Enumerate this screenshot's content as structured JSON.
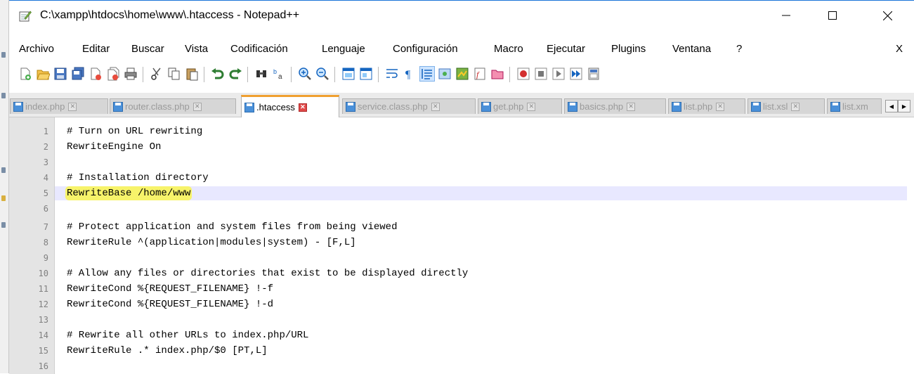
{
  "window": {
    "title": "C:\\xampp\\htdocs\\home\\www\\.htaccess - Notepad++",
    "minimize_label": "—",
    "maximize_label": "☐",
    "close_label": "✕"
  },
  "menu": {
    "items": [
      "Archivo",
      "Editar",
      "Buscar",
      "Vista",
      "Codificación",
      "Lenguaje",
      "Configuración",
      "Macro",
      "Ejecutar",
      "Plugins",
      "Ventana",
      "?"
    ],
    "close_label": "X"
  },
  "toolbar": {
    "icons": [
      "new-file",
      "open-file",
      "save",
      "save-all",
      "close",
      "close-all",
      "print",
      "cut",
      "copy",
      "paste",
      "undo",
      "redo",
      "find",
      "replace",
      "zoom-in",
      "zoom-out",
      "sync-vertical",
      "sync-horizontal",
      "word-wrap",
      "show-all-chars",
      "indent-guide",
      "user-defined-language",
      "document-map",
      "function-list",
      "folder-as-workspace",
      "record-macro",
      "stop-macro",
      "play-macro",
      "run-macro-multiple",
      "save-macro"
    ]
  },
  "tabs": [
    {
      "label": "index.php",
      "active": false
    },
    {
      "label": "router.class.php",
      "active": false
    },
    {
      "label": ".htaccess",
      "active": true
    },
    {
      "label": "service.class.php",
      "active": false
    },
    {
      "label": "get.php",
      "active": false
    },
    {
      "label": "basics.php",
      "active": false
    },
    {
      "label": "list.php",
      "active": false
    },
    {
      "label": "list.xsl",
      "active": false
    },
    {
      "label": "list.xm",
      "active": false
    }
  ],
  "tab_close_glyph": "✕",
  "tab_scroll": {
    "left": "◀",
    "right": "▶"
  },
  "editor": {
    "current_line": 5,
    "highlighted_text": "RewriteBase /home/www",
    "lines": [
      {
        "num": "1",
        "text": "# Turn on URL rewriting"
      },
      {
        "num": "2",
        "text": "RewriteEngine On"
      },
      {
        "num": "3",
        "text": ""
      },
      {
        "num": "4",
        "text": "# Installation directory"
      },
      {
        "num": "5",
        "text": "RewriteBase /home/www"
      },
      {
        "num": "6",
        "text": ""
      },
      {
        "num": "7",
        "text": "# Protect application and system files from being viewed"
      },
      {
        "num": "8",
        "text": "RewriteRule ^(application|modules|system) - [F,L]"
      },
      {
        "num": "9",
        "text": ""
      },
      {
        "num": "10",
        "text": "# Allow any files or directories that exist to be displayed directly"
      },
      {
        "num": "11",
        "text": "RewriteCond %{REQUEST_FILENAME} !-f"
      },
      {
        "num": "12",
        "text": "RewriteCond %{REQUEST_FILENAME} !-d"
      },
      {
        "num": "13",
        "text": ""
      },
      {
        "num": "14",
        "text": "# Rewrite all other URLs to index.php/URL"
      },
      {
        "num": "15",
        "text": "RewriteRule .* index.php/$0 [PT,L]"
      },
      {
        "num": "16",
        "text": ""
      }
    ]
  },
  "colors": {
    "active_tab_accent": "#f0a030",
    "current_line_bg": "#e8e8ff",
    "highlight_marker": "#f7f36a",
    "gutter_bg": "#e4e4e4"
  }
}
